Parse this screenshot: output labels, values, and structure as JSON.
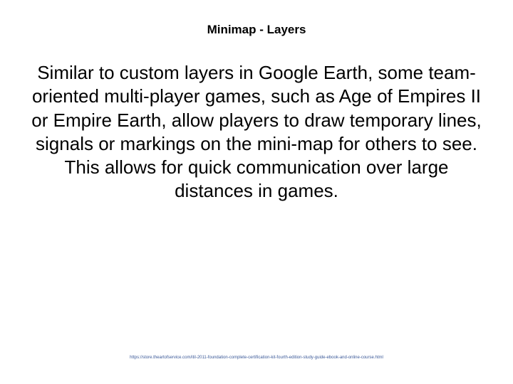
{
  "slide": {
    "title": "Minimap - Layers",
    "body": "Similar to custom layers in Google Earth, some team-oriented multi-player games, such as Age of Empires II or Empire Earth, allow players to draw temporary lines, signals or markings on the mini-map for others to see. This allows for quick communication over large distances in games.",
    "footer_url": "https://store.theartofservice.com/itil-2011-foundation-complete-certification-kit-fourth-edition-study-guide-ebook-and-online-course.html"
  }
}
